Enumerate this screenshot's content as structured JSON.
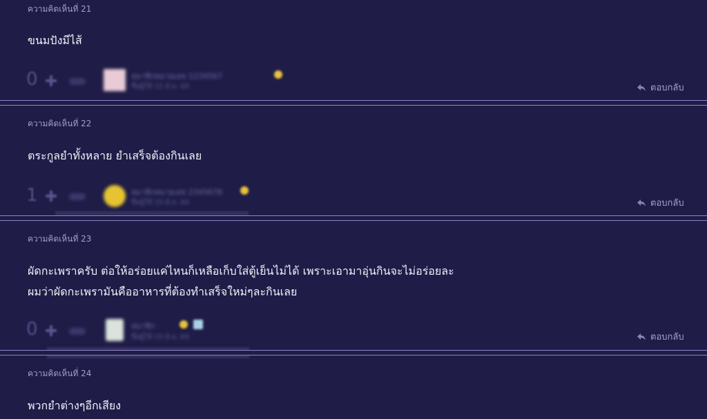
{
  "comments": [
    {
      "number": "ความคิดเห็นที่ 21",
      "text_lines": [
        "ขนมปังมีไส้"
      ],
      "votes": "0",
      "user_name": "สมาชิกหมายเลข 1234567",
      "user_meta": "ชื่อผู้ใช้ 15 มิ.ย. 64",
      "reply_label": "ตอบกลับ"
    },
    {
      "number": "ความคิดเห็นที่ 22",
      "text_lines": [
        "ตระกูลยำทั้งหลาย ยำเสร็จต้องกินเลย"
      ],
      "votes": "1",
      "user_name": "สมาชิกหมายเลข 2345678",
      "user_meta": "ชื่อผู้ใช้ 15 มิ.ย. 64",
      "reply_label": "ตอบกลับ"
    },
    {
      "number": "ความคิดเห็นที่ 23",
      "text_lines": [
        "ผัดกะเพราครับ ต่อให้อร่อยแค่ไหนก็เหลือเก็บใส่ตู้เย็นไม่ได้ เพราะเอามาอุ่นกินจะไม่อร่อยละ",
        "ผมว่าผัดกะเพรามันคืออาหารที่ต้องทำเสร็จใหม่ๆละกินเลย"
      ],
      "votes": "0",
      "user_name": "สมาชิก",
      "user_meta": "ชื่อผู้ใช้ 15 มิ.ย. 64",
      "reply_label": "ตอบกลับ"
    },
    {
      "number": "ความคิดเห็นที่ 24",
      "text_lines": [
        "พวกยำต่างๆอีกเสียง"
      ]
    }
  ],
  "colors": {
    "background": "#1f1d47",
    "divider": "#8e84c8",
    "meta_text": "#a29fc9",
    "body_text": "#f2f1fb"
  },
  "icons": {
    "vote": "plus-icon",
    "reply": "reply-arrow-icon",
    "badge": "star-badge-icon"
  }
}
